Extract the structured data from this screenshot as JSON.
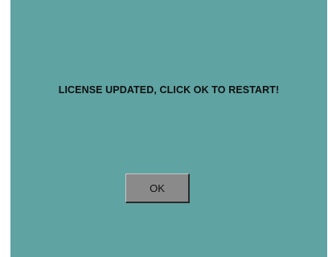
{
  "dialog": {
    "message": "LICENSE UPDATED, CLICK OK TO RESTART!",
    "ok_label": "OK"
  },
  "colors": {
    "background": "#5fa3a2",
    "button": "#8a8a8a",
    "text": "#101010"
  }
}
